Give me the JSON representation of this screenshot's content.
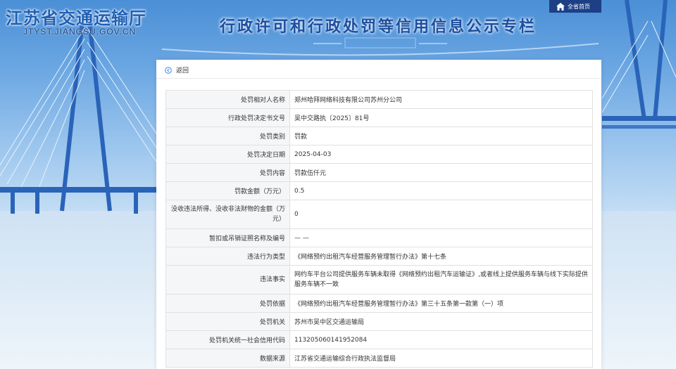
{
  "header": {
    "site_title": "江苏省交通运输厅",
    "site_url": "JTYST.JIANGSU.GOV.CN",
    "banner_title": "行政许可和行政处罚等信用信息公示专栏",
    "home_link": "全省首页"
  },
  "nav": {
    "back_label": "返回"
  },
  "record": [
    {
      "label": "处罚相对人名称",
      "value": "郑州哈拜网络科技有限公司苏州分公司"
    },
    {
      "label": "行政处罚决定书文号",
      "value": "吴中交路执〔2025〕81号"
    },
    {
      "label": "处罚类别",
      "value": "罚款"
    },
    {
      "label": "处罚决定日期",
      "value": "2025-04-03"
    },
    {
      "label": "处罚内容",
      "value": "罚款伍仟元"
    },
    {
      "label": "罚款金额（万元）",
      "value": "0.5"
    },
    {
      "label": "没收违法所得、没收非法财物的金额（万元）",
      "value": "0"
    },
    {
      "label": "暂扣或吊销证照名称及编号",
      "value": "— —"
    },
    {
      "label": "违法行为类型",
      "value": "《网络预约出租汽车经营服务管理暂行办法》第十七条"
    },
    {
      "label": "违法事实",
      "value": "网约车平台公司提供服务车辆未取得《网络预约出租汽车运输证》,或者线上提供服务车辆与线下实际提供服务车辆不一致"
    },
    {
      "label": "处罚依据",
      "value": "《网络预约出租汽车经营服务管理暂行办法》第三十五条第一款第（一）项"
    },
    {
      "label": "处罚机关",
      "value": "苏州市吴中区交通运输局"
    },
    {
      "label": "处罚机关统一社会信用代码",
      "value": "113205060141952084"
    },
    {
      "label": "数据来源",
      "value": "江苏省交通运输综合行政执法监督局"
    }
  ]
}
